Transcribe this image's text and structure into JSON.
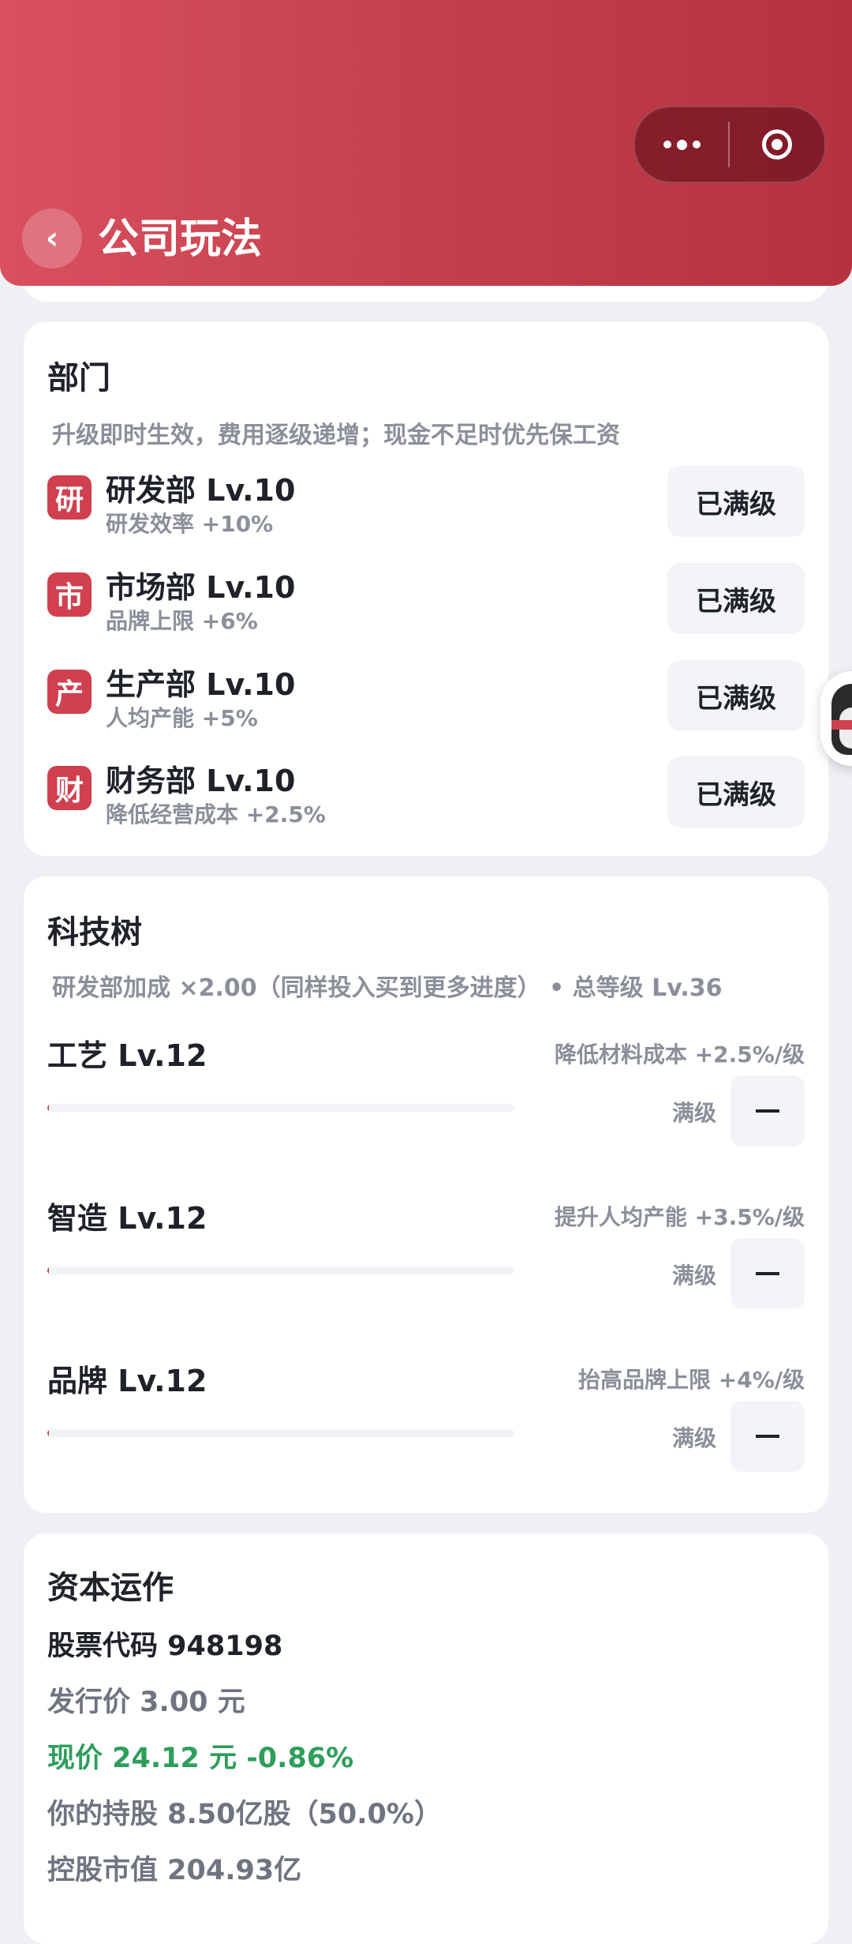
{
  "header": {
    "title": "公司玩法",
    "back_symbol": "‹"
  },
  "departments": {
    "title": "部门",
    "subtitle": "升级即时生效，费用逐级递增；现金不足时优先保工资",
    "items": [
      {
        "icon": "研",
        "name": "研发部 Lv.10",
        "effect": "研发效率 +10%",
        "button": "已满级"
      },
      {
        "icon": "市",
        "name": "市场部 Lv.10",
        "effect": "品牌上限 +6%",
        "button": "已满级"
      },
      {
        "icon": "产",
        "name": "生产部 Lv.10",
        "effect": "人均产能 +5%",
        "button": "已满级"
      },
      {
        "icon": "财",
        "name": "财务部 Lv.10",
        "effect": "降低经营成本 +2.5%",
        "button": "已满级"
      }
    ]
  },
  "tech": {
    "title": "科技树",
    "subtitle": "研发部加成 ×2.00（同样投入买到更多进度） • 总等级 Lv.36",
    "items": [
      {
        "name": "工艺  Lv.12",
        "effect": "降低材料成本 +2.5%/级",
        "status": "满级",
        "progress": 0
      },
      {
        "name": "智造  Lv.12",
        "effect": "提升人均产能 +3.5%/级",
        "status": "满级",
        "progress": 0
      },
      {
        "name": "品牌  Lv.12",
        "effect": "抬高品牌上限 +4%/级",
        "status": "满级",
        "progress": 0
      }
    ]
  },
  "capital": {
    "title": "资本运作",
    "stock_code": "股票代码 948198",
    "issue_price": "发行价 3.00 元",
    "current_price": "现价 24.12 元  -0.86%",
    "holdings": "你的持股 8.50亿股（50.0%）",
    "market_value": "控股市值 204.93亿"
  },
  "colors": {
    "accent": "#d0404f",
    "positive": "#2e9e5b",
    "muted": "#8a8f99"
  }
}
